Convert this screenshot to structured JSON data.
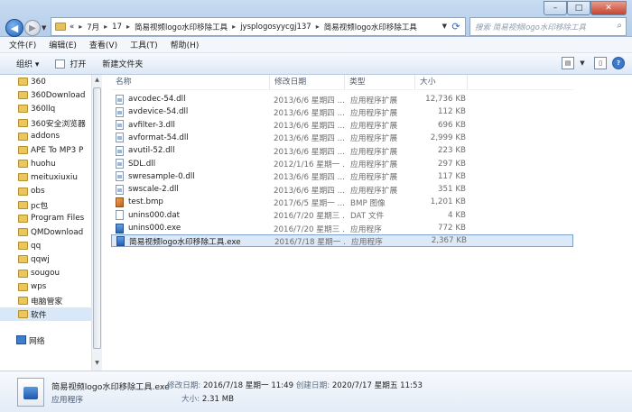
{
  "address": {
    "crumbs": [
      "«",
      "7月",
      "17",
      "简易视频logo水印移除工具",
      "jysplogosyycgj137",
      "简易视频logo水印移除工具"
    ]
  },
  "search": {
    "placeholder": "搜索 简易视频logo水印移除工具"
  },
  "menu": [
    "文件(F)",
    "编辑(E)",
    "查看(V)",
    "工具(T)",
    "帮助(H)"
  ],
  "toolbar": {
    "organize": "组织 ▾",
    "open": "打开",
    "new_folder": "新建文件夹"
  },
  "nav": {
    "items": [
      "360",
      "360Download",
      "360llq",
      "360安全浏览器",
      "addons",
      "APE To MP3 P",
      "huohu",
      "meituxiuxiu",
      "obs",
      "pc包",
      "Program Files",
      "QMDownload",
      "qq",
      "qqwj",
      "sougou",
      "wps",
      "电脑管家",
      "软件"
    ],
    "selected_index": 17,
    "network": "网络"
  },
  "columns": {
    "name": "名称",
    "date": "修改日期",
    "type": "类型",
    "size": "大小"
  },
  "files": [
    {
      "name": "avcodec-54.dll",
      "date": "2013/6/6 星期四 ...",
      "type": "应用程序扩展",
      "size": "12,736 KB",
      "icon": "dll"
    },
    {
      "name": "avdevice-54.dll",
      "date": "2013/6/6 星期四 ...",
      "type": "应用程序扩展",
      "size": "112 KB",
      "icon": "dll"
    },
    {
      "name": "avfilter-3.dll",
      "date": "2013/6/6 星期四 ...",
      "type": "应用程序扩展",
      "size": "696 KB",
      "icon": "dll"
    },
    {
      "name": "avformat-54.dll",
      "date": "2013/6/6 星期四 ...",
      "type": "应用程序扩展",
      "size": "2,999 KB",
      "icon": "dll"
    },
    {
      "name": "avutil-52.dll",
      "date": "2013/6/6 星期四 ...",
      "type": "应用程序扩展",
      "size": "223 KB",
      "icon": "dll"
    },
    {
      "name": "SDL.dll",
      "date": "2012/1/16 星期一 ...",
      "type": "应用程序扩展",
      "size": "297 KB",
      "icon": "dll"
    },
    {
      "name": "swresample-0.dll",
      "date": "2013/6/6 星期四 ...",
      "type": "应用程序扩展",
      "size": "117 KB",
      "icon": "dll"
    },
    {
      "name": "swscale-2.dll",
      "date": "2013/6/6 星期四 ...",
      "type": "应用程序扩展",
      "size": "351 KB",
      "icon": "dll"
    },
    {
      "name": "test.bmp",
      "date": "2017/6/5 星期一 ...",
      "type": "BMP 图像",
      "size": "1,201 KB",
      "icon": "bmp"
    },
    {
      "name": "unins000.dat",
      "date": "2016/7/20 星期三 ...",
      "type": "DAT 文件",
      "size": "4 KB",
      "icon": "dat"
    },
    {
      "name": "unins000.exe",
      "date": "2016/7/20 星期三 ...",
      "type": "应用程序",
      "size": "772 KB",
      "icon": "exe"
    },
    {
      "name": "简易视频logo水印移除工具.exe",
      "date": "2016/7/18 星期一 ...",
      "type": "应用程序",
      "size": "2,367 KB",
      "icon": "exe2"
    }
  ],
  "selected_file_index": 11,
  "details": {
    "name": "简易视频logo水印移除工具.exe",
    "type": "应用程序",
    "modified_label": "修改日期:",
    "modified": "2016/7/18 星期一 11:49",
    "created_label": "创建日期:",
    "created": "2020/7/17 星期五 11:53",
    "size_label": "大小:",
    "size": "2.31 MB"
  }
}
